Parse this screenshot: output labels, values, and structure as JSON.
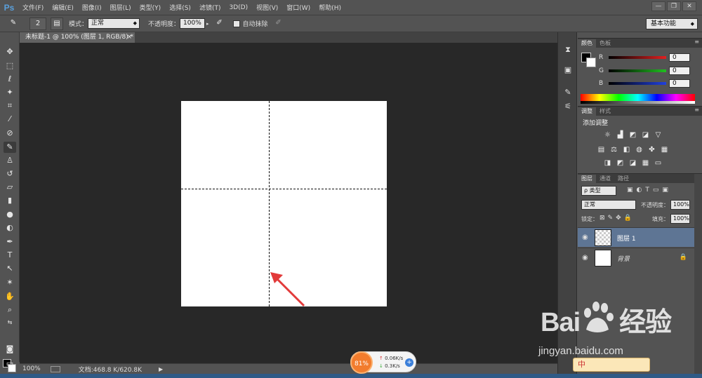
{
  "app": {
    "logo": "Ps",
    "menu": [
      "文件(F)",
      "编辑(E)",
      "图像(I)",
      "图层(L)",
      "类型(Y)",
      "选择(S)",
      "滤镜(T)",
      "3D(D)",
      "视图(V)",
      "窗口(W)",
      "帮助(H)"
    ],
    "window_buttons": [
      "—",
      "❐",
      "✕"
    ]
  },
  "options_bar": {
    "brush_size": "2",
    "mode_label": "模式：",
    "mode_value": "正常",
    "opacity_label": "不透明度：",
    "opacity_value": "100%",
    "auto_erase_label": "自动抹除",
    "workspace": "基本功能"
  },
  "document": {
    "tab_title": "未标题-1 @ 100% (图层 1, RGB/8) *",
    "close": "×"
  },
  "status": {
    "zoom": "100%",
    "doc_info": "文档:468.8 K/620.8K"
  },
  "color_panel": {
    "tabs": [
      "颜色",
      "色板"
    ],
    "channels": [
      {
        "label": "R",
        "value": "0",
        "color": "#e22020"
      },
      {
        "label": "G",
        "value": "0",
        "color": "#20c020"
      },
      {
        "label": "B",
        "value": "0",
        "color": "#2040e0"
      }
    ]
  },
  "adjustments_panel": {
    "tabs": [
      "调整",
      "样式"
    ],
    "title": "添加调整"
  },
  "layers_panel": {
    "tabs": [
      "图层",
      "通道",
      "路径"
    ],
    "filter": "ρ 类型",
    "blend_mode": "正常",
    "opacity_label": "不透明度：",
    "opacity_value": "100%",
    "lock_label": "锁定：",
    "fill_label": "填充：",
    "fill_value": "100%",
    "layers": [
      {
        "name": "图层 1",
        "selected": true,
        "locked": false
      },
      {
        "name": "背景",
        "selected": false,
        "locked": true
      }
    ]
  },
  "net_widget": {
    "percent": "81%",
    "up": "0.06K/s",
    "down": "0.3K/s"
  },
  "watermark": {
    "brand": "Bai",
    "brand_tail": "经验",
    "url": "jingyan.baidu.com"
  },
  "ime": {
    "label": "中"
  }
}
